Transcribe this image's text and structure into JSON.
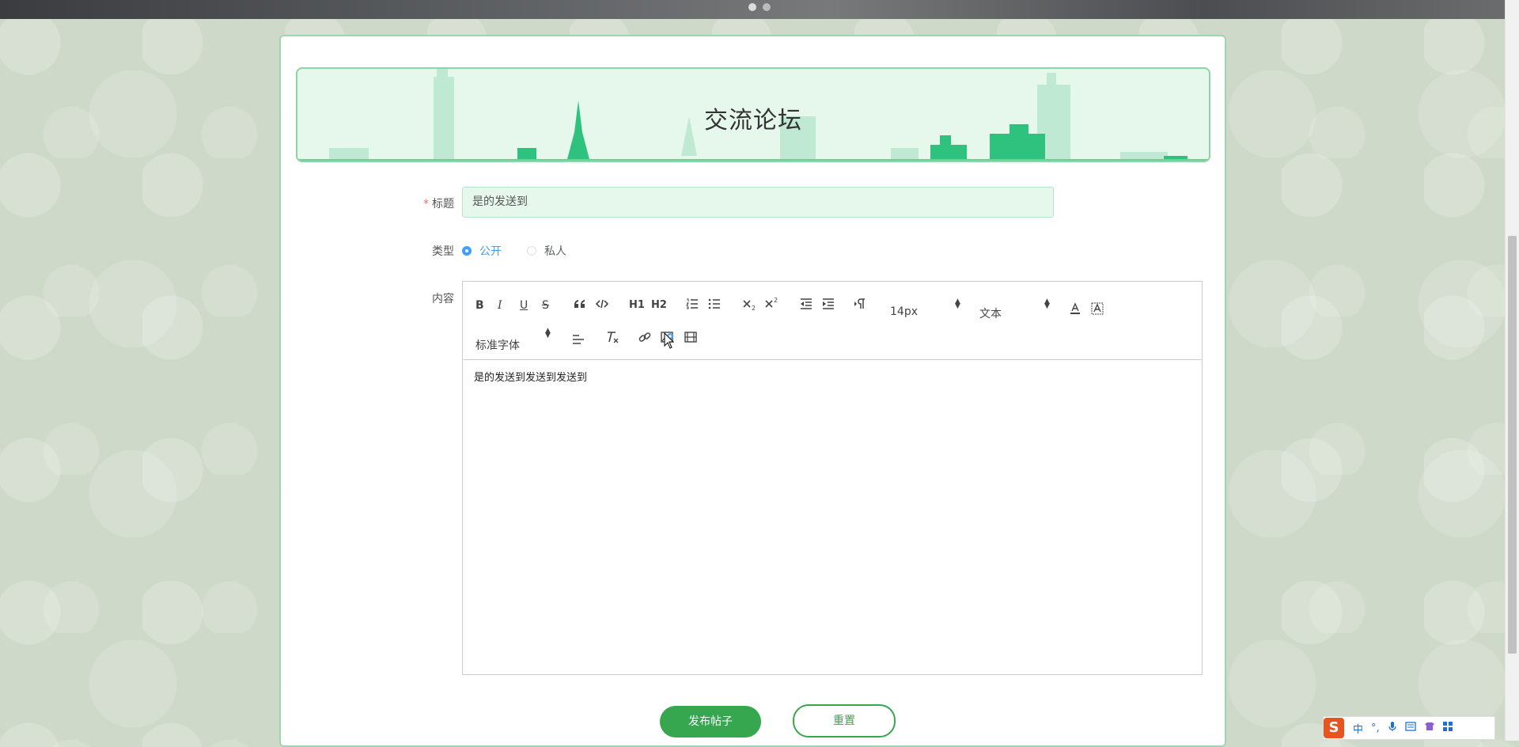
{
  "banner": {
    "title": "交流论坛"
  },
  "form": {
    "title_label": "标题",
    "title_required_mark": "*",
    "title_value": "是的发送到",
    "type_label": "类型",
    "type_options": [
      {
        "label": "公开",
        "checked": true
      },
      {
        "label": "私人",
        "checked": false
      }
    ],
    "content_label": "内容"
  },
  "editor": {
    "toolbar": {
      "bold": "B",
      "italic": "I",
      "underline": "U",
      "strike": "S",
      "h1": "H1",
      "h2": "H2",
      "size_value": "14px",
      "header_value": "文本",
      "font_value": "标准字体"
    },
    "icons": [
      "bold-icon",
      "italic-icon",
      "underline-icon",
      "strike-icon",
      "blockquote-icon",
      "code-block-icon",
      "h1-icon",
      "h2-icon",
      "ordered-list-icon",
      "bullet-list-icon",
      "subscript-icon",
      "superscript-icon",
      "outdent-icon",
      "indent-icon",
      "text-direction-icon",
      "font-color-icon",
      "background-color-icon",
      "align-icon",
      "clean-format-icon",
      "link-icon",
      "image-icon",
      "video-icon"
    ],
    "content": "是的发送到发送到发送到"
  },
  "buttons": {
    "submit": "发布帖子",
    "reset": "重置"
  },
  "ime": {
    "logo": "S",
    "mode": "中",
    "punct": "°,"
  },
  "colors": {
    "accent": "#36a64f",
    "radio": "#409eff",
    "banner_bg": "#e6f7ec"
  }
}
